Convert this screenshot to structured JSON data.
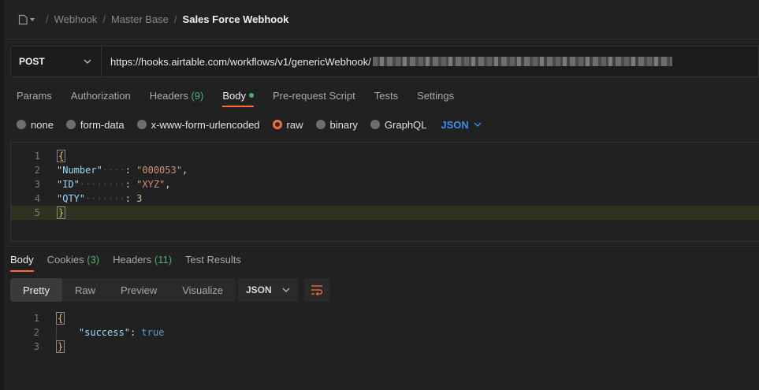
{
  "breadcrumb": {
    "items": [
      "Webhook",
      "Master Base"
    ],
    "current": "Sales Force Webhook"
  },
  "request": {
    "method": "POST",
    "url": "https://hooks.airtable.com/workflows/v1/genericWebhook/"
  },
  "request_tabs": [
    {
      "label": "Params"
    },
    {
      "label": "Authorization"
    },
    {
      "label": "Headers",
      "count": "(9)"
    },
    {
      "label": "Body"
    },
    {
      "label": "Pre-request Script"
    },
    {
      "label": "Tests"
    },
    {
      "label": "Settings"
    }
  ],
  "body_types": [
    "none",
    "form-data",
    "x-www-form-urlencoded",
    "raw",
    "binary",
    "GraphQL"
  ],
  "body_format": "JSON",
  "request_body": {
    "line_numbers": [
      "1",
      "2",
      "3",
      "4",
      "5"
    ],
    "open_brace": "{",
    "close_brace": "}",
    "fields": [
      {
        "key": "\"Number\"",
        "pad": "····",
        "value": "\"000053\"",
        "trail": ","
      },
      {
        "key": "\"ID\"",
        "pad": "········",
        "value": "\"XYZ\"",
        "trail": ","
      },
      {
        "key": "\"QTY\"",
        "pad": "·······",
        "value": "3",
        "trail": ""
      }
    ]
  },
  "response_tabs": [
    {
      "label": "Body"
    },
    {
      "label": "Cookies",
      "count": "(3)"
    },
    {
      "label": "Headers",
      "count": "(11)"
    },
    {
      "label": "Test Results"
    }
  ],
  "view_modes": [
    "Pretty",
    "Raw",
    "Preview",
    "Visualize"
  ],
  "response_format": "JSON",
  "response_body": {
    "line_numbers": [
      "1",
      "2",
      "3"
    ],
    "open_brace": "{",
    "close_brace": "}",
    "key": "\"success\"",
    "value": "true"
  },
  "colors": {
    "accent": "#ff6c37",
    "count_green": "#4caf6e",
    "link_blue": "#3b8eea"
  },
  "icons": {
    "collection": "request-doc-icon",
    "chevron": "chevron-down-icon",
    "wrap": "wrap-lines-icon"
  }
}
